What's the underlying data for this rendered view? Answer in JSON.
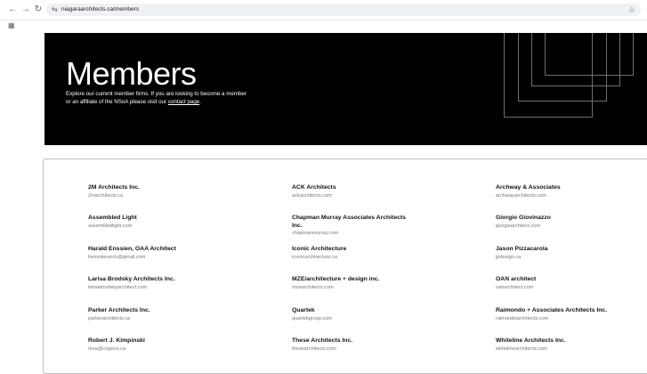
{
  "browser": {
    "url": "niagaraarchitects.ca/members",
    "back_glyph": "←",
    "forward_glyph": "→",
    "reload_glyph": "↻",
    "site_glyph": "⇆",
    "star_glyph": "☆",
    "apps_glyph": "▦"
  },
  "hero": {
    "title": "Members",
    "description": "Explore our current member firms. If you are looking to become a member or an affiliate of the NSoA please visit our",
    "link_text": "contact page",
    "period": "."
  },
  "members": [
    {
      "name": "2M Architects Inc.",
      "site": "2marchitects.ca"
    },
    {
      "name": "ACK Architects",
      "site": "ackarchitects.com"
    },
    {
      "name": "Archway & Associates",
      "site": "archwayarchitects.com"
    },
    {
      "name": "Assembled Light",
      "site": "assembledlight.com"
    },
    {
      "name": "Chapman Murray Associates Architects Inc.",
      "site": "chapmanmurray.com"
    },
    {
      "name": "Giorgio Giovinazzo",
      "site": "giorgioarchitect.com"
    },
    {
      "name": "Harald Enssien, OAA Architect",
      "site": "henssienarch@gmail.com"
    },
    {
      "name": "Iconic Architecture",
      "site": "iconicarchitecture.ca"
    },
    {
      "name": "Jason Pizzacarola",
      "site": "jpdesign.ca"
    },
    {
      "name": "Larisa Brodsky Architects Inc.",
      "site": "larisabrodskyarchitect.com"
    },
    {
      "name": "MZE/architecture + design inc.",
      "site": "mzearchitects.com"
    },
    {
      "name": "OAN architect",
      "site": "oanarchitect.com"
    },
    {
      "name": "Parker Architects Inc.",
      "site": "parkerarchitects.ca"
    },
    {
      "name": "Quartek",
      "site": "quartekgroup.com"
    },
    {
      "name": "Raimondo + Associates Architects Inc.",
      "site": "raimondoarchitects.com"
    },
    {
      "name": "Robert J. Kimpinski",
      "site": "rkoa@cogeco.ca"
    },
    {
      "name": "These Architects Inc.",
      "site": "thesearchitects.com"
    },
    {
      "name": "Whiteline Architects Inc.",
      "site": "whitelinearchitects.com"
    }
  ]
}
